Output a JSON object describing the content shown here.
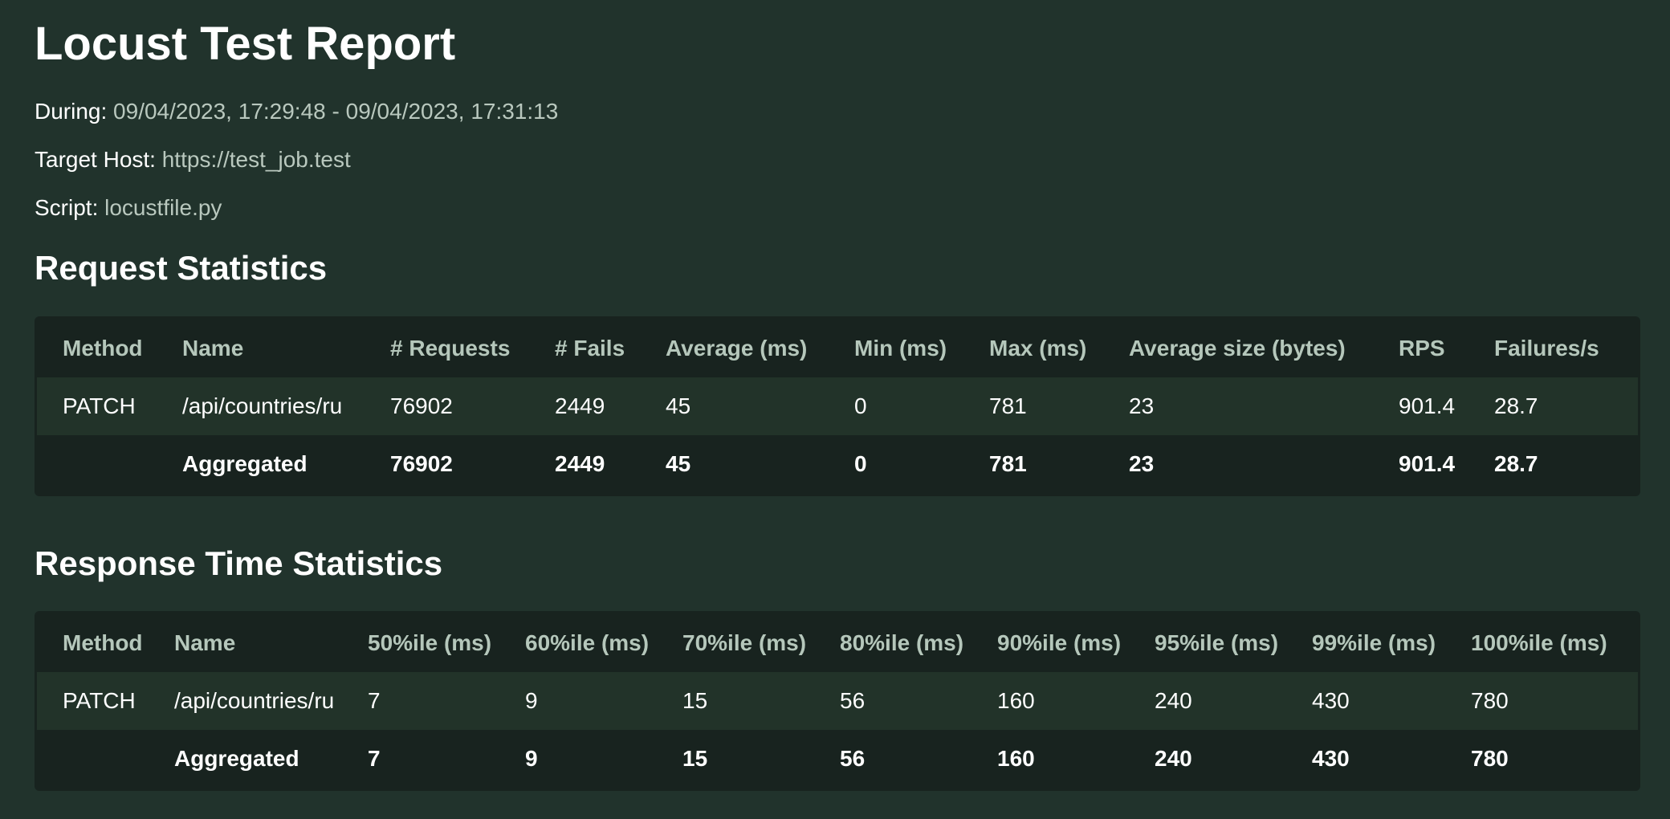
{
  "report": {
    "title": "Locust Test Report",
    "during_label": "During:",
    "during_value": "09/04/2023, 17:29:48 - 09/04/2023, 17:31:13",
    "host_label": "Target Host:",
    "host_value": "https://test_job.test",
    "script_label": "Script:",
    "script_value": "locustfile.py"
  },
  "request_stats": {
    "heading": "Request Statistics",
    "columns": [
      "Method",
      "Name",
      "# Requests",
      "# Fails",
      "Average (ms)",
      "Min (ms)",
      "Max (ms)",
      "Average size (bytes)",
      "RPS",
      "Failures/s"
    ],
    "rows": [
      [
        "PATCH",
        "/api/countries/ru",
        "76902",
        "2449",
        "45",
        "0",
        "781",
        "23",
        "901.4",
        "28.7"
      ]
    ],
    "aggregated": [
      "",
      "Aggregated",
      "76902",
      "2449",
      "45",
      "0",
      "781",
      "23",
      "901.4",
      "28.7"
    ]
  },
  "response_stats": {
    "heading": "Response Time Statistics",
    "columns": [
      "Method",
      "Name",
      "50%ile (ms)",
      "60%ile (ms)",
      "70%ile (ms)",
      "80%ile (ms)",
      "90%ile (ms)",
      "95%ile (ms)",
      "99%ile (ms)",
      "100%ile (ms)"
    ],
    "rows": [
      [
        "PATCH",
        "/api/countries/ru",
        "7",
        "9",
        "15",
        "56",
        "160",
        "240",
        "430",
        "780"
      ]
    ],
    "aggregated": [
      "",
      "Aggregated",
      "7",
      "9",
      "15",
      "56",
      "160",
      "240",
      "430",
      "780"
    ]
  }
}
